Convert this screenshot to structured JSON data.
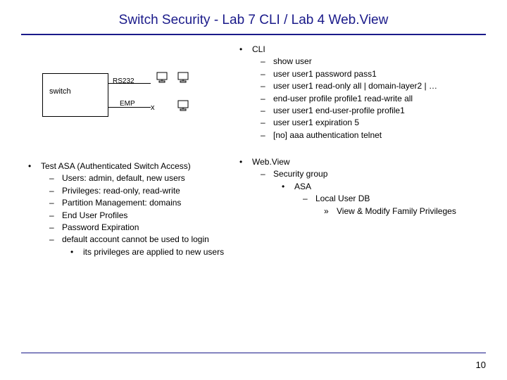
{
  "title": "Switch Security - Lab 7 CLI / Lab 4 Web.View",
  "diagram": {
    "switch_label": "switch",
    "rs232_label": "RS232",
    "emp_label": "EMP",
    "emp_x": "x"
  },
  "cli": {
    "heading": "CLI",
    "items": [
      "show user",
      "user user1 password pass1",
      "user user1 read-only all | domain-layer2 | …",
      "end-user profile profile1 read-write all",
      "user user1 end-user-profile profile1",
      "user user1 expiration 5",
      "[no] aaa authentication telnet"
    ]
  },
  "webview": {
    "heading": "Web.View",
    "l2": "Security group",
    "l3": "ASA",
    "l4": "Local User DB",
    "l5": "View & Modify Family Privileges"
  },
  "asa": {
    "heading": "Test ASA (Authenticated Switch Access)",
    "items": [
      "Users: admin, default, new users",
      "Privileges: read-only, read-write",
      "Partition Management: domains",
      "End User Profiles",
      "Password Expiration",
      "default account cannot be used to login"
    ],
    "sub": "its privileges are applied to new users"
  },
  "page_number": "10"
}
